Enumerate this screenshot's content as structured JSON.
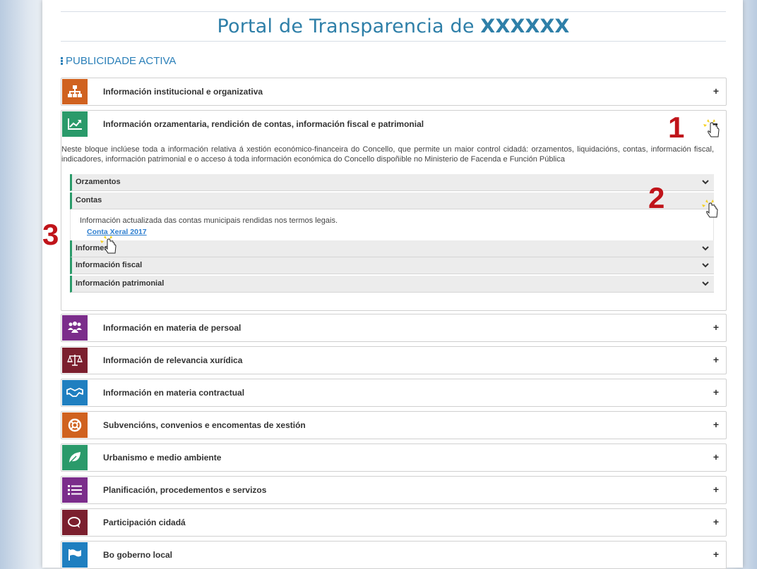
{
  "header": {
    "title_prefix": "Portal de Transparencia de ",
    "title_name": "XXXXXX",
    "section": "PUBLICIDADE ACTIVA"
  },
  "accordions": [
    {
      "title": "Información institucional e organizativa",
      "color": "#d0621f",
      "icon": "org-chart-icon",
      "toggle": "+"
    },
    {
      "title": "Información orzamentaria, rendición de contas, información fiscal e patrimonial",
      "color": "#2a9a6a",
      "icon": "trend-chart-icon",
      "expanded": true
    },
    {
      "title": "Información en materia de persoal",
      "color": "#7b2d8b",
      "icon": "people-icon",
      "toggle": "+"
    },
    {
      "title": "Información de relevancia xurídica",
      "color": "#7b1f2e",
      "icon": "scales-icon",
      "toggle": "+"
    },
    {
      "title": "Información en materia contractual",
      "color": "#1f7fc0",
      "icon": "handshake-icon",
      "toggle": "+"
    },
    {
      "title": "Subvencións, convenios e encomentas de xestión",
      "color": "#d0621f",
      "icon": "lifebuoy-icon",
      "toggle": "+"
    },
    {
      "title": "Urbanismo e medio ambiente",
      "color": "#2a9a6a",
      "icon": "leaf-icon",
      "toggle": "+"
    },
    {
      "title": "Planificación, procedementos e servizos",
      "color": "#7b2d8b",
      "icon": "list-icon",
      "toggle": "+"
    },
    {
      "title": "Participación cidadá",
      "color": "#7b1f2e",
      "icon": "chat-icon",
      "toggle": "+"
    },
    {
      "title": "Bo goberno local",
      "color": "#1f7fc0",
      "icon": "flag-icon",
      "toggle": "+"
    }
  ],
  "expanded": {
    "description": "Neste bloque inclúese toda a información relativa á xestión económico-financeira do Concello, que permite un maior control cidadá: orzamentos, liquidacións, contas, información fiscal, indicadores, información patrimonial e o acceso á toda información económica do Concello dispoñible no Ministerio de Facenda e Función Pública",
    "subsections": [
      {
        "label": "Orzamentos"
      },
      {
        "label": "Contas"
      },
      {
        "label": "Informes"
      },
      {
        "label": "Información fiscal"
      },
      {
        "label": "Información patrimonial"
      }
    ],
    "contas_body": "Información actualizada das contas municipais rendidas nos termos legais.",
    "contas_link": "Conta Xeral 2017"
  },
  "annotations": [
    "1",
    "2",
    "3"
  ]
}
